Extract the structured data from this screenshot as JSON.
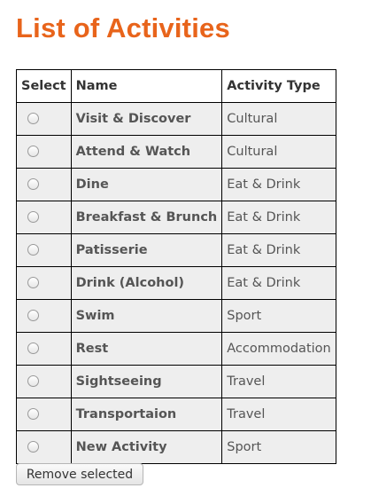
{
  "page": {
    "title": "List of Activities"
  },
  "table": {
    "headers": {
      "select": "Select",
      "name": "Name",
      "type": "Activity Type"
    },
    "rows": [
      {
        "name": "Visit & Discover",
        "type": "Cultural",
        "selected": false
      },
      {
        "name": "Attend & Watch",
        "type": "Cultural",
        "selected": false
      },
      {
        "name": "Dine",
        "type": "Eat & Drink",
        "selected": false
      },
      {
        "name": "Breakfast & Brunch",
        "type": "Eat & Drink",
        "selected": false
      },
      {
        "name": "Patisserie",
        "type": "Eat & Drink",
        "selected": false
      },
      {
        "name": "Drink (Alcohol)",
        "type": "Eat & Drink",
        "selected": false
      },
      {
        "name": "Swim",
        "type": "Sport",
        "selected": false
      },
      {
        "name": "Rest",
        "type": "Accommodation",
        "selected": false
      },
      {
        "name": "Sightseeing",
        "type": "Travel",
        "selected": false
      },
      {
        "name": "Transportaion",
        "type": "Travel",
        "selected": false
      },
      {
        "name": "New Activity",
        "type": "Sport",
        "selected": false
      }
    ]
  },
  "actions": {
    "remove_label": "Remove selected"
  },
  "colors": {
    "title": "#e8641b",
    "row_background": "#eeeeee",
    "border": "#000000"
  }
}
